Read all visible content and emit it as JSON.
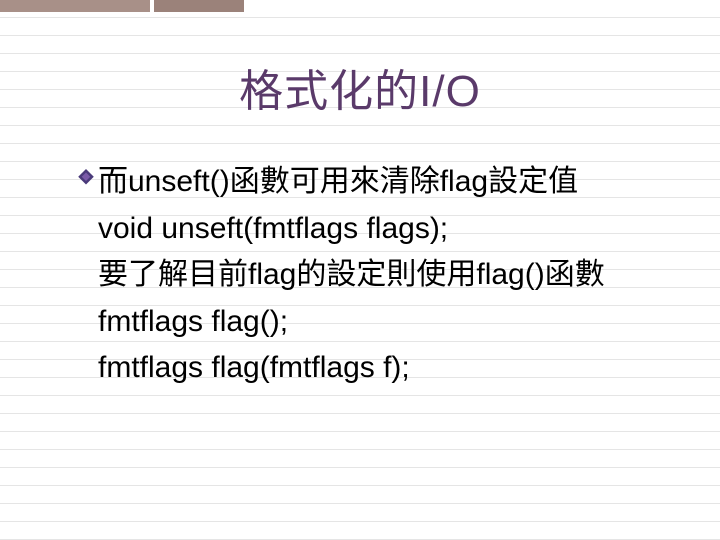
{
  "title": "格式化的I/O",
  "lines": {
    "l1": "而unseft()函數可用來清除flag設定值",
    "l2": "void unseft(fmtflags flags);",
    "l3": "要了解目前flag的設定則使用flag()函數",
    "l4": "fmtflags flag();",
    "l5": "fmtflags flag(fmtflags f);"
  }
}
